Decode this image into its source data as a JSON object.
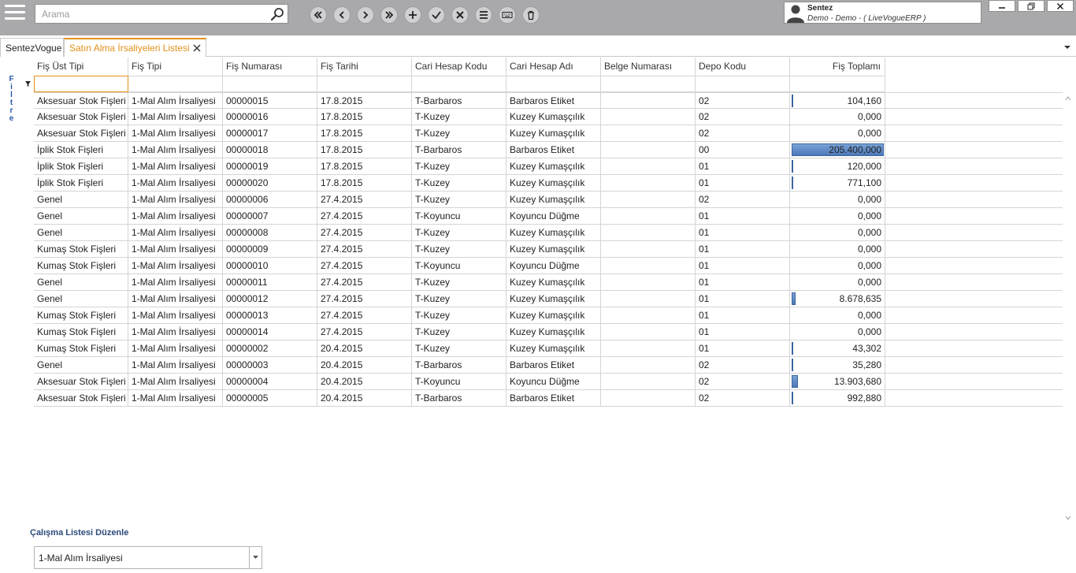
{
  "toolbar": {
    "search_placeholder": "Arama",
    "buttons": [
      {
        "name": "first-record-button",
        "icon": "double-chevron-left-icon"
      },
      {
        "name": "prev-record-button",
        "icon": "chevron-left-icon"
      },
      {
        "name": "next-record-button",
        "icon": "chevron-right-icon"
      },
      {
        "name": "last-record-button",
        "icon": "double-chevron-right-icon"
      },
      {
        "name": "add-button",
        "icon": "plus-icon"
      },
      {
        "name": "save-button",
        "icon": "check-icon"
      },
      {
        "name": "cancel-button",
        "icon": "x-icon"
      },
      {
        "name": "list-button",
        "icon": "list-icon"
      },
      {
        "name": "keyboard-button",
        "icon": "keyboard-icon"
      },
      {
        "name": "delete-button",
        "icon": "trash-icon"
      }
    ]
  },
  "user": {
    "name": "Sentez",
    "detail": "Demo - Demo - ( LiveVogueERP )"
  },
  "tabs": [
    {
      "label": "SentezVogue",
      "active": false
    },
    {
      "label": "Satın Alma İrsaliyeleri Listesi",
      "active": true
    }
  ],
  "filter_label": "Filtre",
  "grid": {
    "columns": [
      "Fiş Üst Tipi",
      "Fiş Tipi",
      "Fiş Numarası",
      "Fiş Tarihi",
      "Cari Hesap Kodu",
      "Cari Hesap Adı",
      "Belge Numarası",
      "Depo Kodu",
      "Fiş Toplamı"
    ],
    "rows": [
      [
        "Aksesuar Stok Fişleri",
        "1-Mal Alım İrsaliyesi",
        "00000015",
        "17.8.2015",
        "T-Barbaros",
        "Barbaros Etiket",
        "",
        "02",
        "104,160"
      ],
      [
        "Aksesuar Stok Fişleri",
        "1-Mal Alım İrsaliyesi",
        "00000016",
        "17.8.2015",
        "T-Kuzey",
        "Kuzey Kumaşçılık",
        "",
        "02",
        "0,000"
      ],
      [
        "Aksesuar Stok Fişleri",
        "1-Mal Alım İrsaliyesi",
        "00000017",
        "17.8.2015",
        "T-Kuzey",
        "Kuzey Kumaşçılık",
        "",
        "02",
        "0,000"
      ],
      [
        "İplik Stok Fişleri",
        "1-Mal Alım İrsaliyesi",
        "00000018",
        "17.8.2015",
        "T-Barbaros",
        "Barbaros Etiket",
        "",
        "00",
        "205.400,000"
      ],
      [
        "İplik Stok Fişleri",
        "1-Mal Alım İrsaliyesi",
        "00000019",
        "17.8.2015",
        "T-Kuzey",
        "Kuzey Kumaşçılık",
        "",
        "01",
        "120,000"
      ],
      [
        "İplik Stok Fişleri",
        "1-Mal Alım İrsaliyesi",
        "00000020",
        "17.8.2015",
        "T-Kuzey",
        "Kuzey Kumaşçılık",
        "",
        "01",
        "771,100"
      ],
      [
        "Genel",
        "1-Mal Alım İrsaliyesi",
        "00000006",
        "27.4.2015",
        "T-Kuzey",
        "Kuzey Kumaşçılık",
        "",
        "02",
        "0,000"
      ],
      [
        "Genel",
        "1-Mal Alım İrsaliyesi",
        "00000007",
        "27.4.2015",
        "T-Koyuncu",
        "Koyuncu Düğme",
        "",
        "01",
        "0,000"
      ],
      [
        "Genel",
        "1-Mal Alım İrsaliyesi",
        "00000008",
        "27.4.2015",
        "T-Kuzey",
        "Kuzey Kumaşçılık",
        "",
        "01",
        "0,000"
      ],
      [
        "Kumaş Stok Fişleri",
        "1-Mal Alım İrsaliyesi",
        "00000009",
        "27.4.2015",
        "T-Kuzey",
        "Kuzey Kumaşçılık",
        "",
        "01",
        "0,000"
      ],
      [
        "Kumaş Stok Fişleri",
        "1-Mal Alım İrsaliyesi",
        "00000010",
        "27.4.2015",
        "T-Koyuncu",
        "Koyuncu Düğme",
        "",
        "01",
        "0,000"
      ],
      [
        "Genel",
        "1-Mal Alım İrsaliyesi",
        "00000011",
        "27.4.2015",
        "T-Kuzey",
        "Kuzey Kumaşçılık",
        "",
        "01",
        "0,000"
      ],
      [
        "Genel",
        "1-Mal Alım İrsaliyesi",
        "00000012",
        "27.4.2015",
        "T-Kuzey",
        "Kuzey Kumaşçılık",
        "",
        "01",
        "8.678,635"
      ],
      [
        "Kumaş Stok Fişleri",
        "1-Mal Alım İrsaliyesi",
        "00000013",
        "27.4.2015",
        "T-Kuzey",
        "Kuzey Kumaşçılık",
        "",
        "01",
        "0,000"
      ],
      [
        "Kumaş Stok Fişleri",
        "1-Mal Alım İrsaliyesi",
        "00000014",
        "27.4.2015",
        "T-Kuzey",
        "Kuzey Kumaşçılık",
        "",
        "01",
        "0,000"
      ],
      [
        "Kumaş Stok Fişleri",
        "1-Mal Alım İrsaliyesi",
        "00000002",
        "20.4.2015",
        "T-Kuzey",
        "Kuzey Kumaşçılık",
        "",
        "01",
        "43,302"
      ],
      [
        "Genel",
        "1-Mal Alım İrsaliyesi",
        "00000003",
        "20.4.2015",
        "T-Barbaros",
        "Barbaros Etiket",
        "",
        "02",
        "35,280"
      ],
      [
        "Aksesuar Stok Fişleri",
        "1-Mal Alım İrsaliyesi",
        "00000004",
        "20.4.2015",
        "T-Koyuncu",
        "Koyuncu Düğme",
        "",
        "02",
        "13.903,680"
      ],
      [
        "Aksesuar Stok Fişleri",
        "1-Mal Alım İrsaliyesi",
        "00000005",
        "20.4.2015",
        "T-Barbaros",
        "Barbaros Etiket",
        "",
        "02",
        "992,880"
      ]
    ],
    "bar_fractions": [
      0.0005,
      0,
      0,
      1.0,
      0.0006,
      0.0038,
      0,
      0,
      0,
      0,
      0,
      0,
      0.042,
      0,
      0,
      0.0002,
      0.0002,
      0.068,
      0.0048
    ],
    "bar_color": "#4b78b8"
  },
  "work_list": {
    "label": "Çalışma Listesi Düzenle",
    "selected": "1-Mal Alım İrsaliyesi"
  },
  "colors": {
    "topbar": "#a9a9ab",
    "active_tab": "#e3901a",
    "filter_label": "#2a5aa8"
  }
}
